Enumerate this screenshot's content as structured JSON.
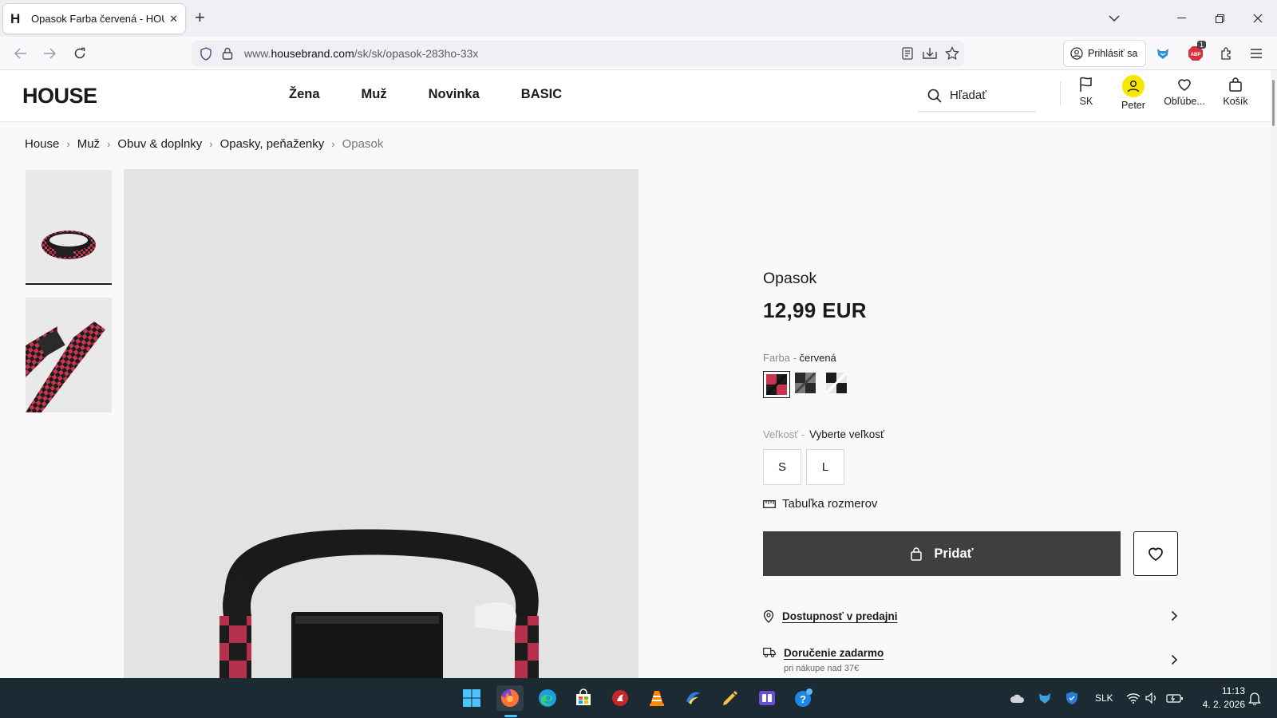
{
  "browser": {
    "tab_title": "Opasok Farba červená - HOUSE",
    "tab_favicon": "H",
    "url_prefix": "www.",
    "url_host": "housebrand.com",
    "url_path": "/sk/sk/opasok-283ho-33x",
    "signin_label": "Prihlásiť sa",
    "abp_badge": "1"
  },
  "site": {
    "logo": "HOUSE",
    "nav": [
      "Žena",
      "Muž",
      "Novinka",
      "BASIC"
    ],
    "search_placeholder": "Hľadať",
    "header_items": {
      "language": "SK",
      "account": "Peter",
      "favorites": "Obľúbe...",
      "cart": "Košík"
    }
  },
  "breadcrumb": [
    "House",
    "Muž",
    "Obuv & doplnky",
    "Opasky, peňaženky",
    "Opasok"
  ],
  "product": {
    "title": "Opasok",
    "price": "12,99 EUR",
    "color_label": "Farba",
    "color_value": "červená",
    "color_separator": " - ",
    "swatches": [
      {
        "name": "red-black",
        "colors": [
          "#c8354e",
          "#1c1c1c"
        ],
        "selected": true
      },
      {
        "name": "grey-black",
        "colors": [
          "#8a8a8a",
          "#2a2a2a"
        ],
        "selected": false
      },
      {
        "name": "white-black",
        "colors": [
          "#f0f0f0",
          "#1c1c1c"
        ],
        "selected": false
      }
    ],
    "size_label": "Veľkosť -",
    "size_value": "Vyberte veľkosť",
    "sizes": [
      "S",
      "L"
    ],
    "size_table": "Tabuľka rozmerov",
    "add_button": "Pridať",
    "store_availability": "Dostupnosť v predajni",
    "delivery": "Doručenie zadarmo",
    "delivery_sub": "pri nákupe nad 37€"
  },
  "taskbar": {
    "language": "SLK",
    "time": "11:13",
    "date": "4. 2. 2026"
  },
  "colors": {
    "accent_dark": "#3f3f3f",
    "avatar_yellow": "#f6e600",
    "taskbar_bg": "#1c2b33",
    "belt_red": "#c8354e"
  }
}
